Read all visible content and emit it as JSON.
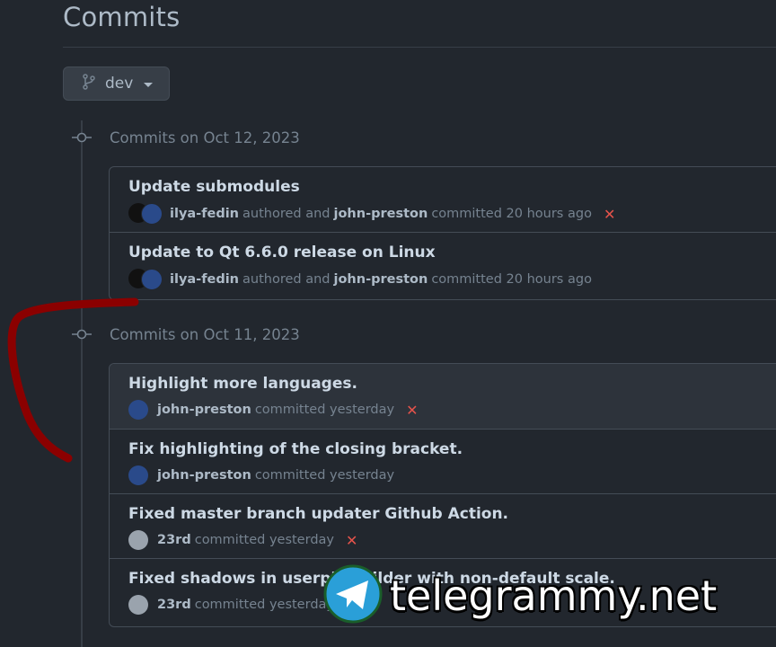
{
  "page": {
    "title": "Commits"
  },
  "branch": {
    "name": "dev"
  },
  "groups": [
    {
      "label": "Commits on Oct 12, 2023",
      "commits": [
        {
          "message": "Update submodules",
          "author": "ilya-fedin",
          "authored_text": "authored and",
          "committer": "john-preston",
          "when": "committed 20 hours ago",
          "status": "failed"
        },
        {
          "message": "Update to Qt 6.6.0 release on Linux",
          "author": "ilya-fedin",
          "authored_text": "authored and",
          "committer": "john-preston",
          "when": "committed 20 hours ago",
          "status": "none"
        }
      ]
    },
    {
      "label": "Commits on Oct 11, 2023",
      "commits": [
        {
          "message": "Highlight more languages.",
          "committer": "john-preston",
          "when": "committed yesterday",
          "status": "failed"
        },
        {
          "message": "Fix highlighting of the closing bracket.",
          "committer": "john-preston",
          "when": "committed yesterday",
          "status": "none"
        },
        {
          "message": "Fixed master branch updater Github Action.",
          "committer": "23rd",
          "when": "committed yesterday",
          "status": "failed"
        },
        {
          "message": "Fixed shadows in userpic builder with non-default scale.",
          "committer": "23rd",
          "when": "committed yesterday",
          "status": "none"
        }
      ]
    }
  ],
  "icons": {
    "branch": "git-branch-icon",
    "commit": "git-commit-icon",
    "status_failed": "x-icon"
  },
  "watermark": {
    "text": "telegrammy.net"
  },
  "colors": {
    "background": "#22272e",
    "border": "#444c56",
    "failed": "#e5534b",
    "annotation": "#8b0000"
  }
}
